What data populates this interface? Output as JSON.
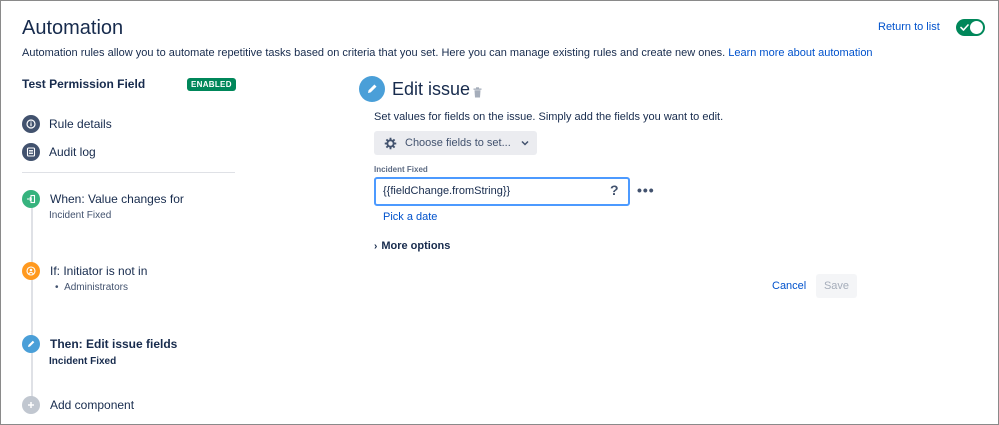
{
  "header": {
    "title": "Automation",
    "description": "Automation rules allow you to automate repetitive tasks based on criteria that you set. Here you can manage existing rules and create new ones.",
    "learn_more": "Learn more about automation",
    "return_link": "Return to list",
    "toggle_on": true
  },
  "sidebar": {
    "rule_name": "Test Permission Field",
    "status_badge": "ENABLED",
    "links": [
      {
        "label": "Rule details",
        "icon": "info-icon"
      },
      {
        "label": "Audit log",
        "icon": "log-icon"
      }
    ],
    "steps": [
      {
        "title": "When: Value changes for",
        "subtitle": "Incident Fixed",
        "icon": "trigger-icon",
        "color": "#36b37e"
      },
      {
        "title": "If: Initiator is not in",
        "subtitle": "Administrators",
        "icon": "user-condition-icon",
        "color": "#ff991f"
      },
      {
        "title": "Then: Edit issue fields",
        "subtitle": "Incident Fixed",
        "icon": "pencil-icon",
        "color": "#4a9fd8"
      }
    ],
    "add_component": "Add component"
  },
  "panel": {
    "title": "Edit issue",
    "description": "Set values for fields on the issue. Simply add the fields you want to edit.",
    "choose_fields": "Choose fields to set...",
    "field_label": "Incident Fixed",
    "field_value": "{{fieldChange.fromString}}",
    "help_symbol": "?",
    "more_symbol": "•••",
    "pick_date": "Pick a date",
    "more_options": "More options",
    "cancel": "Cancel",
    "save": "Save"
  },
  "colors": {
    "brand_link": "#0052cc",
    "enabled_green": "#00875a",
    "focus_blue": "#4c9aff"
  }
}
